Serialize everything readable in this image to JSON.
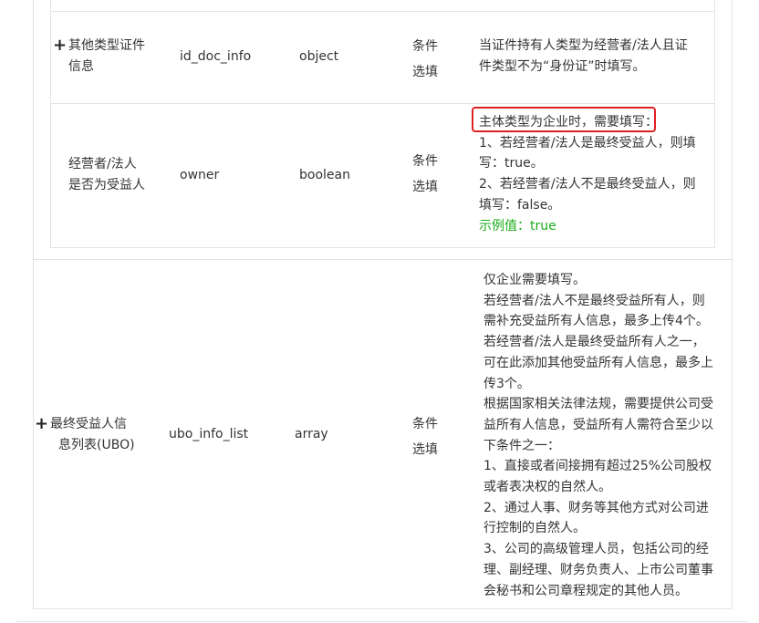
{
  "table": {
    "rows": [
      {
        "name": [
          "其他类型证件",
          "信息"
        ],
        "field": "id_doc_info",
        "type": "object",
        "required": [
          "条件",
          "选填"
        ],
        "description": [
          "当证件持有人类型为经营者/法人且证",
          "件类型不为“身份证”时填写。"
        ]
      },
      {
        "name": [
          "经营者/法人",
          "是否为受益人"
        ],
        "field": "owner",
        "type": "boolean",
        "required": [
          "条件",
          "选填"
        ],
        "description": [
          "主体类型为企业时，需要填写：",
          "1、若经营者/法人是最终受益人，则填",
          "写：true。",
          "2、若经营者/法人不是最终受益人，则",
          "填写：false。"
        ],
        "example": "示例值：true"
      },
      {
        "name": [
          "最终受益人信",
          "息列表(UBO)"
        ],
        "field": "ubo_info_list",
        "type": "array",
        "required": [
          "条件",
          "选填"
        ],
        "description": [
          "仅企业需要填写。",
          "若经营者/法人不是最终受益所有人，则",
          "需补充受益所有人信息，最多上传4个。",
          "若经营者/法人是最终受益所有人之一，",
          "可在此添加其他受益所有人信息，最多上",
          "传3个。",
          "根据国家相关法律法规，需要提供公司受",
          "益所有人信息，受益所有人需符合至少以",
          "下条件之一：",
          "1、直接或者间接拥有超过25%公司股权",
          "或者表决权的自然人。",
          "2、通过人事、财务等其他方式对公司进",
          "行控制的自然人。",
          "3、公司的高级管理人员，包括公司的经",
          "理、副经理、财务负责人、上市公司董事",
          "会秘书和公司章程规定的其他人员。"
        ]
      }
    ],
    "expand_icon": "plus-icon",
    "highlight_color": "#e02020",
    "example_color": "#1aad19"
  }
}
